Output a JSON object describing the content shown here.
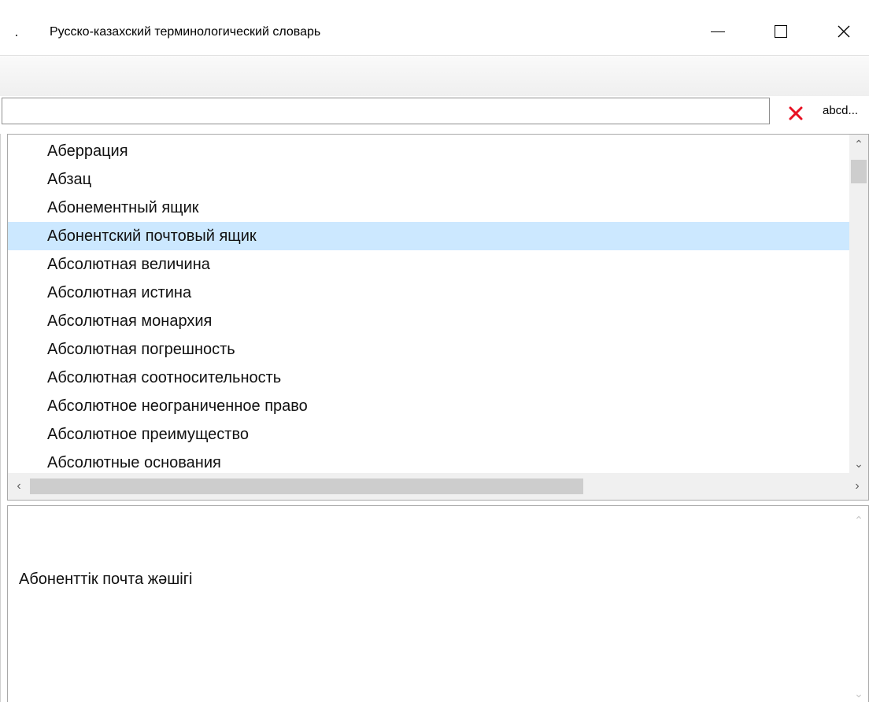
{
  "window": {
    "title": "Русско-казахский терминологический словарь",
    "controls": {
      "minimize": "minimize-icon",
      "maximize": "maximize-icon",
      "close": "close-icon"
    }
  },
  "search": {
    "value": "",
    "placeholder": "",
    "clear_icon": "clear-x-icon",
    "clear_color": "#e81123",
    "abcd_label": "abcd..."
  },
  "term_list": {
    "items": [
      {
        "label": "Аберрация",
        "selected": false
      },
      {
        "label": "Абзац",
        "selected": false
      },
      {
        "label": "Абонементный ящик",
        "selected": false
      },
      {
        "label": "Абонентский почтовый ящик",
        "selected": true
      },
      {
        "label": "Абсолютная величина",
        "selected": false
      },
      {
        "label": "Абсолютная истина",
        "selected": false
      },
      {
        "label": "Абсолютная монархия",
        "selected": false
      },
      {
        "label": "Абсолютная погрешность",
        "selected": false
      },
      {
        "label": "Абсолютная соотносительность",
        "selected": false
      },
      {
        "label": "Абсолютное неограниченное право",
        "selected": false
      },
      {
        "label": "Абсолютное преимущество",
        "selected": false
      },
      {
        "label": "Абсолютные основания",
        "selected": false
      }
    ],
    "selection_color": "#cce8ff"
  },
  "translation": {
    "text": "Абоненттік почта жәшігі"
  }
}
